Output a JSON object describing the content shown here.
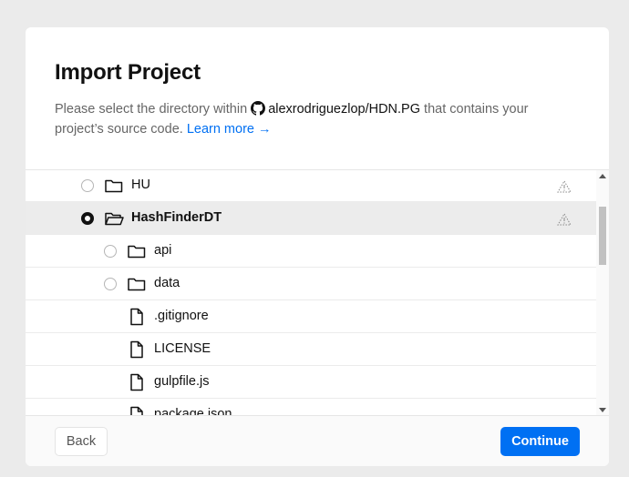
{
  "dialog": {
    "title": "Import Project",
    "desc_before": "Please select the directory within",
    "repo": "alexrodriguezlop/HDN.PG",
    "desc_after": "that contains your project’s source code.",
    "learn_more": "Learn more →"
  },
  "tree": [
    {
      "label": "HU",
      "type": "folder",
      "depth": 0,
      "selected": false,
      "warning": true,
      "icon": "folder-icon"
    },
    {
      "label": "HashFinderDT",
      "type": "folder-open",
      "depth": 0,
      "selected": true,
      "warning": true,
      "icon": "folder-open-icon"
    },
    {
      "label": "api",
      "type": "folder",
      "depth": 1,
      "selected": false,
      "warning": false,
      "icon": "folder-icon"
    },
    {
      "label": "data",
      "type": "folder",
      "depth": 1,
      "selected": false,
      "warning": false,
      "icon": "folder-icon"
    },
    {
      "label": ".gitignore",
      "type": "file",
      "depth": 1,
      "selected": false,
      "warning": false,
      "icon": "file-icon"
    },
    {
      "label": "LICENSE",
      "type": "file",
      "depth": 1,
      "selected": false,
      "warning": false,
      "icon": "file-icon"
    },
    {
      "label": "gulpfile.js",
      "type": "file",
      "depth": 1,
      "selected": false,
      "warning": false,
      "icon": "file-icon"
    },
    {
      "label": "package.json",
      "type": "file",
      "depth": 1,
      "selected": false,
      "warning": false,
      "icon": "file-icon"
    }
  ],
  "footer": {
    "back_label": "Back",
    "continue_label": "Continue"
  },
  "colors": {
    "accent": "#0070f3",
    "selected_row": "#ececec"
  }
}
